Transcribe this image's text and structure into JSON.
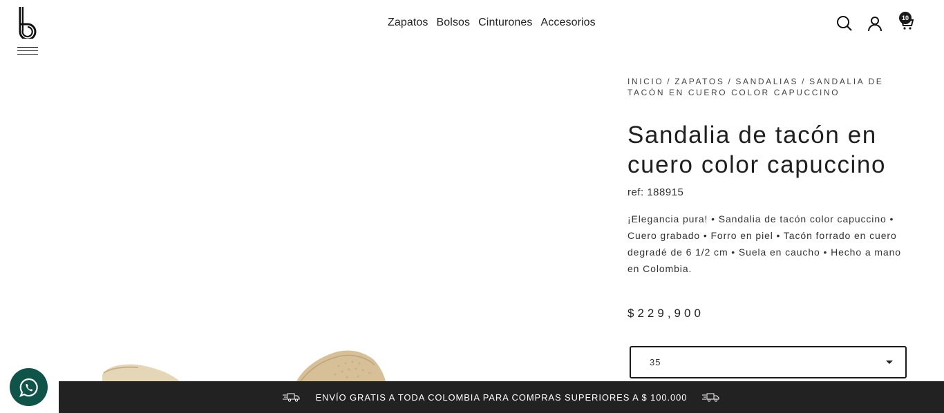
{
  "header": {
    "nav": [
      {
        "label": "Zapatos"
      },
      {
        "label": "Bolsos"
      },
      {
        "label": "Cinturones"
      },
      {
        "label": "Accesorios"
      }
    ],
    "icons": {
      "logo": "brand-logo",
      "menu": "hamburger-icon",
      "search": "search-icon",
      "account": "user-icon",
      "cart": "cart-icon"
    },
    "cart_count": "10"
  },
  "breadcrumb": {
    "items": [
      "INICIO",
      "ZAPATOS",
      "SANDALIAS",
      "SANDALIA DE TACÓN EN CUERO COLOR CAPUCCINO"
    ],
    "separator": "/"
  },
  "product": {
    "title_line1": "Sandalia de tacón en",
    "title_line2": "cuero color capuccino",
    "ref": "ref: 188915",
    "description": "¡Elegancia pura! • Sandalia de tacón color capuccino • Cuero grabado • Forro en piel • Tacón forrado en cuero degradé de 6 1/2 cm • Suela en caucho • Hecho a mano en Colombia.",
    "price": "$229,900",
    "size_selected": "35"
  },
  "banner": {
    "text": "ENVÍO GRATIS A TODA COLOMBIA PARA COMPRAS SUPERIORES A $ 100.000",
    "icon": "delivery-truck-icon"
  },
  "colors": {
    "banner_bg": "#222222",
    "whatsapp_bg": "#0f5448",
    "product_tan": "#d9c29d"
  }
}
